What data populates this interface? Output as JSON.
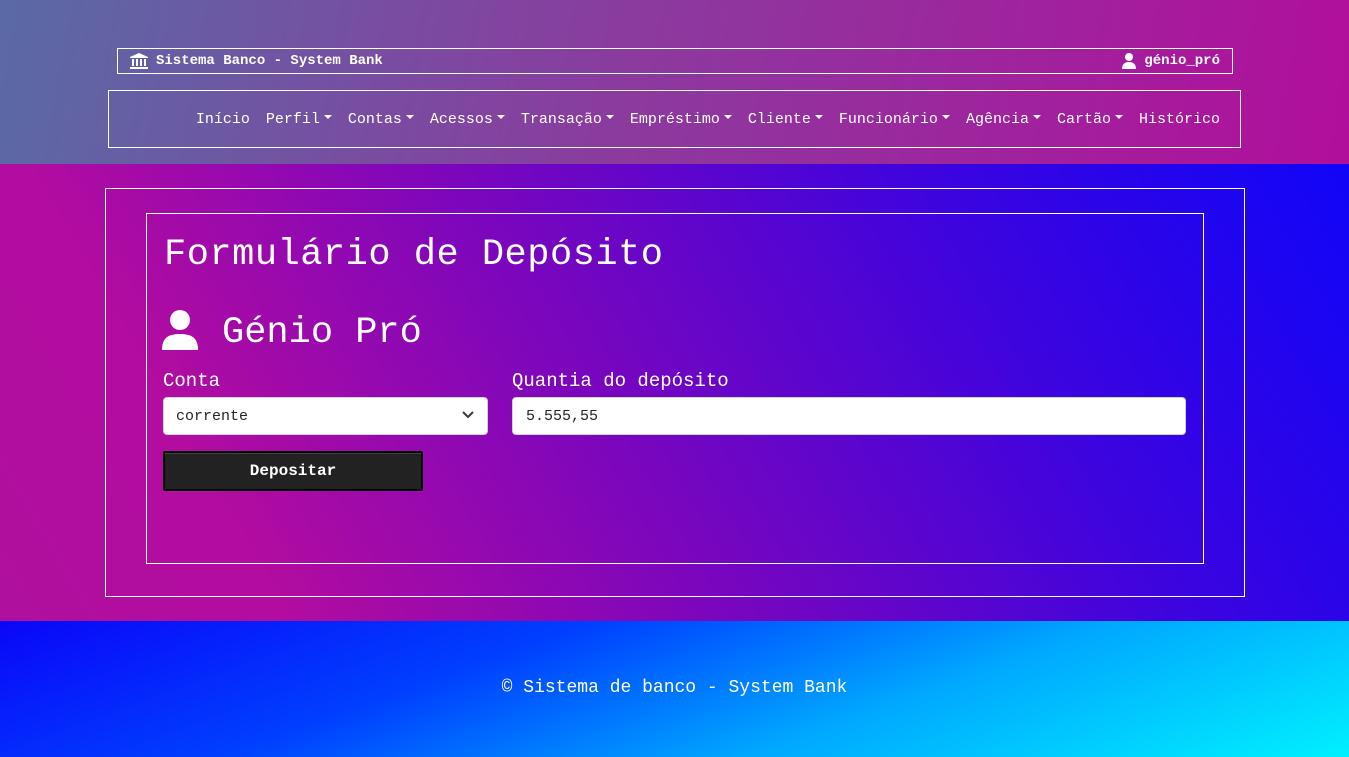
{
  "header": {
    "brand_label": "Sistema Banco - System Bank",
    "brand_icon": "bank-icon",
    "user_label": "génio_pró",
    "user_icon": "user-icon"
  },
  "nav": {
    "items": [
      {
        "label": "Início",
        "dropdown": false
      },
      {
        "label": "Perfil",
        "dropdown": true
      },
      {
        "label": "Contas",
        "dropdown": true
      },
      {
        "label": "Acessos",
        "dropdown": true
      },
      {
        "label": "Transação",
        "dropdown": true
      },
      {
        "label": "Empréstimo",
        "dropdown": true
      },
      {
        "label": "Cliente",
        "dropdown": true
      },
      {
        "label": "Funcionário",
        "dropdown": true
      },
      {
        "label": "Agência",
        "dropdown": true
      },
      {
        "label": "Cartão",
        "dropdown": true
      },
      {
        "label": "Histórico",
        "dropdown": false
      }
    ]
  },
  "form": {
    "title": "Formulário de Depósito",
    "user_name": "Génio Pró",
    "account_label": "Conta",
    "account_value": "corrente",
    "amount_label": "Quantia do depósito",
    "amount_value": "5.555,55",
    "submit_label": "Depositar"
  },
  "footer": {
    "text": "© Sistema de banco - System Bank"
  },
  "colors": {
    "button_bg": "#222222",
    "header_gradient_start": "#5a6aa6",
    "header_gradient_end": "#b10e9c",
    "footer_gradient_end": "#00f0ff"
  }
}
